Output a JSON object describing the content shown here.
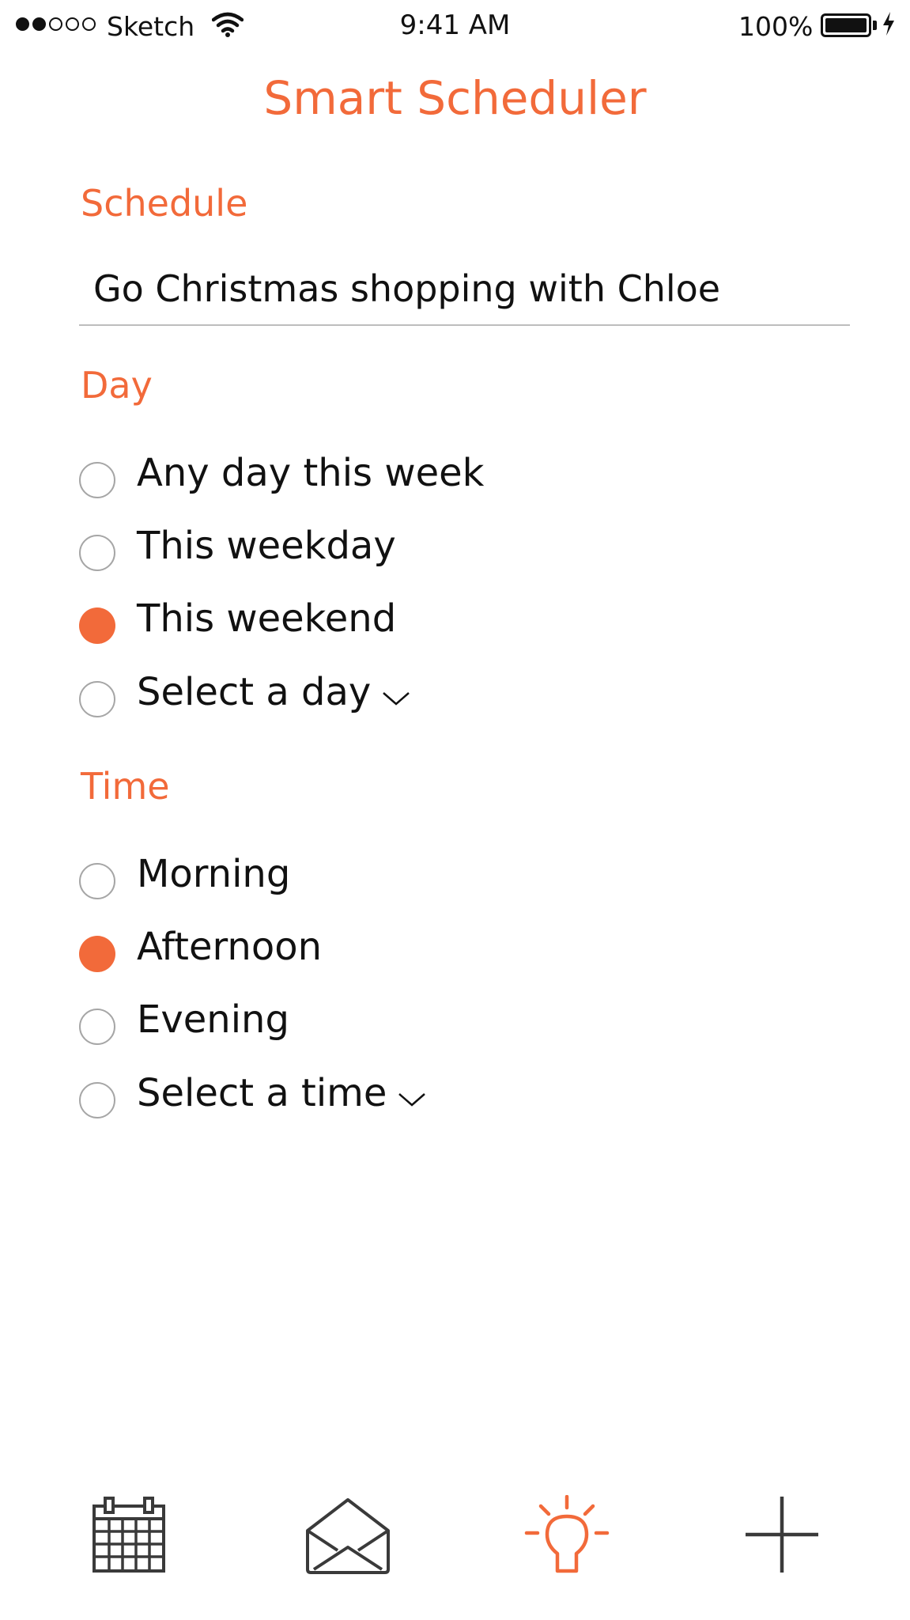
{
  "status_bar": {
    "carrier": "Sketch",
    "time": "9:41 AM",
    "battery": "100%",
    "signal_strength": 2,
    "icons": [
      "signal-dots-icon",
      "wifi-icon",
      "battery-icon",
      "charging-bolt-icon"
    ]
  },
  "app": {
    "title": "Smart Scheduler",
    "accent_color": "#f26a3a"
  },
  "schedule": {
    "label": "Schedule",
    "value": "Go Christmas shopping with Chloe"
  },
  "day": {
    "label": "Day",
    "options": [
      {
        "label": "Any day this week",
        "selected": false
      },
      {
        "label": "This weekday",
        "selected": false
      },
      {
        "label": "This weekend",
        "selected": true
      },
      {
        "label": "Select a day",
        "selected": false,
        "dropdown": true
      }
    ]
  },
  "time": {
    "label": "Time",
    "options": [
      {
        "label": "Morning",
        "selected": false
      },
      {
        "label": "Afternoon",
        "selected": true
      },
      {
        "label": "Evening",
        "selected": false
      },
      {
        "label": "Select a time",
        "selected": false,
        "dropdown": true
      }
    ]
  },
  "tab_bar": {
    "tabs": [
      {
        "icon": "calendar-icon",
        "active": false
      },
      {
        "icon": "mail-open-icon",
        "active": false
      },
      {
        "icon": "lightbulb-icon",
        "active": true
      },
      {
        "icon": "plus-icon",
        "active": false
      }
    ]
  }
}
